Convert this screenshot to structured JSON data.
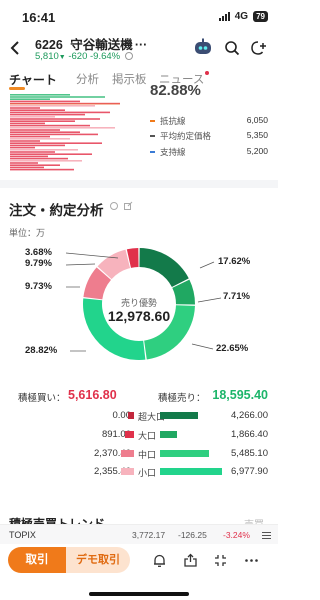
{
  "status": {
    "time": "16:41",
    "network": "4G",
    "battery": "79"
  },
  "header": {
    "code": "6226",
    "name": "守谷輸送機",
    "price": "5,810",
    "change": "-620",
    "change_pct": "-9.64%"
  },
  "tabs": [
    {
      "label": "チャート",
      "active": true
    },
    {
      "label": "分析",
      "active": false
    },
    {
      "label": "掲示板",
      "active": false
    },
    {
      "label": "ニュース",
      "active": false
    }
  ],
  "depth": {
    "pct": "82.88%",
    "legend": [
      {
        "label": "抵抗線",
        "value": "6,050",
        "color": "#f07a1a"
      },
      {
        "label": "平均約定価格",
        "value": "5,350",
        "color": "#555555"
      },
      {
        "label": "支持線",
        "value": "5,200",
        "color": "#3a7bd5"
      }
    ]
  },
  "analysis": {
    "title": "注文・約定分析",
    "unit": "単位：万",
    "center_title": "売り優勢",
    "center_value": "12,978.60",
    "slices": [
      {
        "pct": "17.62%",
        "value": 17.62,
        "color": "#137a4a"
      },
      {
        "pct": "7.71%",
        "value": 7.71,
        "color": "#20a862"
      },
      {
        "pct": "22.65%",
        "value": 22.65,
        "color": "#2fcf80"
      },
      {
        "pct": "28.82%",
        "value": 28.82,
        "color": "#22d48c"
      },
      {
        "pct": "9.73%",
        "value": 9.73,
        "color": "#ee7d8e"
      },
      {
        "pct": "9.79%",
        "value": 9.79,
        "color": "#f7b3bd"
      },
      {
        "pct": "3.68%",
        "value": 3.68,
        "color": "#e0314b"
      }
    ],
    "total_buy_label": "積極買い：",
    "total_buy": "5,616.80",
    "total_sell_label": "積極売り：",
    "total_sell": "18,595.40",
    "rows": [
      {
        "name": "超大口",
        "buy": "0.00",
        "sell": "4,266.00",
        "buy_color": "#c2273d",
        "sell_color": "#137a4a",
        "buy_frac": 0.0,
        "sell_frac": 0.61
      },
      {
        "name": "大口",
        "buy": "891.00",
        "sell": "1,866.40",
        "buy_color": "#e0314b",
        "sell_color": "#20a862",
        "buy_frac": 0.13,
        "sell_frac": 0.27
      },
      {
        "name": "中口",
        "buy": "2,370.40",
        "sell": "5,485.10",
        "buy_color": "#ee7d8e",
        "sell_color": "#2fcf80",
        "buy_frac": 0.34,
        "sell_frac": 0.79
      },
      {
        "name": "小口",
        "buy": "2,355.40",
        "sell": "6,977.90",
        "buy_color": "#f7b3bd",
        "sell_color": "#22d48c",
        "buy_frac": 0.34,
        "sell_frac": 1.0
      }
    ]
  },
  "next_section": {
    "title": "積極売買トレンド",
    "right": "売買"
  },
  "index_bar": {
    "name": "TOPIX",
    "value": "3,772.17",
    "change": "-126.25",
    "change_pct": "-3.24%"
  },
  "bottom": {
    "trade_label": "取引",
    "demo_label": "デモ取引"
  }
}
